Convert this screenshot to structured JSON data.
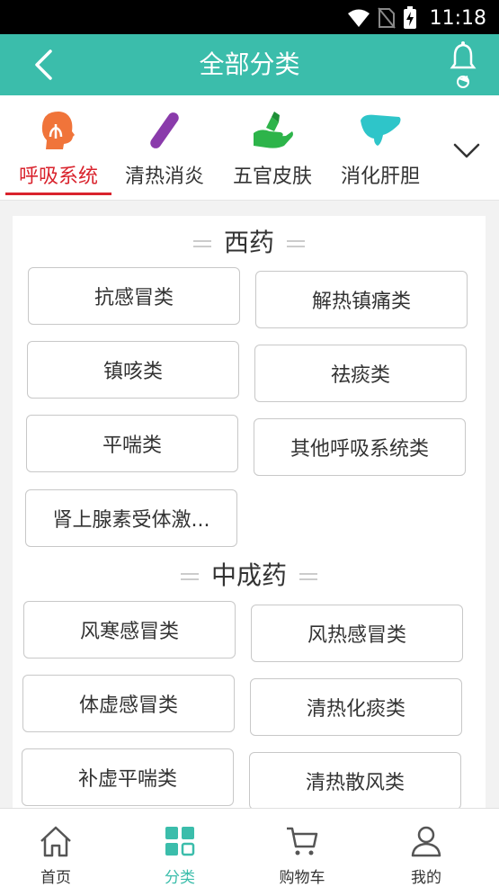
{
  "status_bar": {
    "time": "11:18",
    "icons": [
      "wifi-icon",
      "no-sim-icon",
      "battery-charging-icon"
    ]
  },
  "header": {
    "title": "全部分类",
    "back_icon": "chevron-left-icon",
    "right_icon": "bell-icon"
  },
  "colors": {
    "brand": "#3bbdab",
    "active_tab": "#d9232d",
    "status_bar": "#000000"
  },
  "tabs": [
    {
      "label": "呼吸系统",
      "icon": "respiratory-icon",
      "active": true
    },
    {
      "label": "清热消炎",
      "icon": "capsule-icon",
      "active": false
    },
    {
      "label": "五官皮肤",
      "icon": "hand-care-icon",
      "active": false
    },
    {
      "label": "消化肝胆",
      "icon": "liver-icon",
      "active": false
    }
  ],
  "sections": [
    {
      "title": "西药",
      "items": [
        "抗感冒类",
        "解热镇痛类",
        "镇咳类",
        "祛痰类",
        "平喘类",
        "其他呼吸系统类",
        "肾上腺素受体激..."
      ]
    },
    {
      "title": "中成药",
      "items": [
        "风寒感冒类",
        "风热感冒类",
        "体虚感冒类",
        "清热化痰类",
        "补虚平喘类",
        "清热散风类"
      ]
    }
  ],
  "bottom_nav": [
    {
      "label": "首页",
      "icon": "home-icon",
      "active": false
    },
    {
      "label": "分类",
      "icon": "category-grid-icon",
      "active": true
    },
    {
      "label": "购物车",
      "icon": "cart-icon",
      "active": false
    },
    {
      "label": "我的",
      "icon": "user-icon",
      "active": false
    }
  ]
}
